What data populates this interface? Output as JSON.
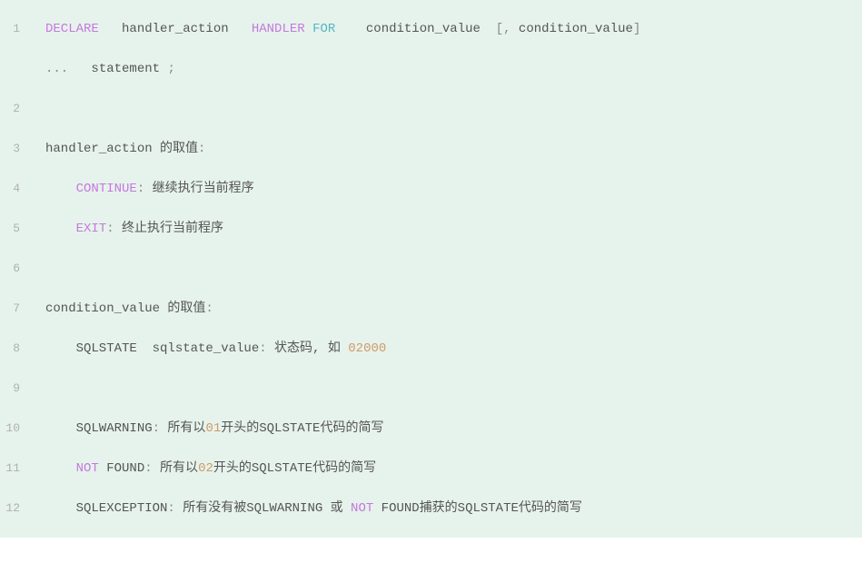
{
  "lines": [
    {
      "num": "1",
      "segments": [
        {
          "cls": "kw-declare",
          "text": "DECLARE"
        },
        {
          "cls": "",
          "text": "   handler_action   "
        },
        {
          "cls": "kw-handler",
          "text": "HANDLER"
        },
        {
          "cls": "",
          "text": " "
        },
        {
          "cls": "kw-for",
          "text": "FOR"
        },
        {
          "cls": "",
          "text": "    condition_value  "
        },
        {
          "cls": "punct",
          "text": "["
        },
        {
          "cls": "punct",
          "text": ","
        },
        {
          "cls": "",
          "text": " condition_value"
        },
        {
          "cls": "punct",
          "text": "]"
        }
      ],
      "wrapped": [
        {
          "cls": "punct",
          "text": "..."
        },
        {
          "cls": "",
          "text": "   statement "
        },
        {
          "cls": "punct",
          "text": ";"
        }
      ]
    },
    {
      "num": "2",
      "segments": []
    },
    {
      "num": "3",
      "segments": [
        {
          "cls": "",
          "text": "handler_action 的取值"
        },
        {
          "cls": "punct",
          "text": ":"
        }
      ]
    },
    {
      "num": "4",
      "segments": [
        {
          "cls": "",
          "text": "    "
        },
        {
          "cls": "kw-continue",
          "text": "CONTINUE"
        },
        {
          "cls": "punct",
          "text": ":"
        },
        {
          "cls": "",
          "text": " 继续执行当前程序"
        }
      ]
    },
    {
      "num": "5",
      "segments": [
        {
          "cls": "",
          "text": "    "
        },
        {
          "cls": "kw-exit",
          "text": "EXIT"
        },
        {
          "cls": "punct",
          "text": ":"
        },
        {
          "cls": "",
          "text": " 终止执行当前程序"
        }
      ]
    },
    {
      "num": "6",
      "segments": []
    },
    {
      "num": "7",
      "segments": [
        {
          "cls": "",
          "text": "condition_value 的取值"
        },
        {
          "cls": "punct",
          "text": ":"
        }
      ]
    },
    {
      "num": "8",
      "segments": [
        {
          "cls": "",
          "text": "    SQLSTATE  sqlstate_value"
        },
        {
          "cls": "punct",
          "text": ":"
        },
        {
          "cls": "",
          "text": " 状态码, 如 "
        },
        {
          "cls": "num",
          "text": "02000"
        }
      ]
    },
    {
      "num": "9",
      "segments": []
    },
    {
      "num": "10",
      "segments": [
        {
          "cls": "",
          "text": "    SQLWARNING"
        },
        {
          "cls": "punct",
          "text": ":"
        },
        {
          "cls": "",
          "text": " 所有以"
        },
        {
          "cls": "num",
          "text": "01"
        },
        {
          "cls": "",
          "text": "开头的SQLSTATE代码的简写"
        }
      ]
    },
    {
      "num": "11",
      "segments": [
        {
          "cls": "",
          "text": "    "
        },
        {
          "cls": "kw-not",
          "text": "NOT"
        },
        {
          "cls": "",
          "text": " FOUND"
        },
        {
          "cls": "punct",
          "text": ":"
        },
        {
          "cls": "",
          "text": " 所有以"
        },
        {
          "cls": "num",
          "text": "02"
        },
        {
          "cls": "",
          "text": "开头的SQLSTATE代码的简写"
        }
      ]
    },
    {
      "num": "12",
      "segments": [
        {
          "cls": "",
          "text": "    SQLEXCEPTION"
        },
        {
          "cls": "punct",
          "text": ":"
        },
        {
          "cls": "",
          "text": " 所有没有被SQLWARNING 或 "
        },
        {
          "cls": "kw-not",
          "text": "NOT"
        },
        {
          "cls": "",
          "text": " FOUND捕获的SQLSTATE代码的简写"
        }
      ]
    }
  ]
}
